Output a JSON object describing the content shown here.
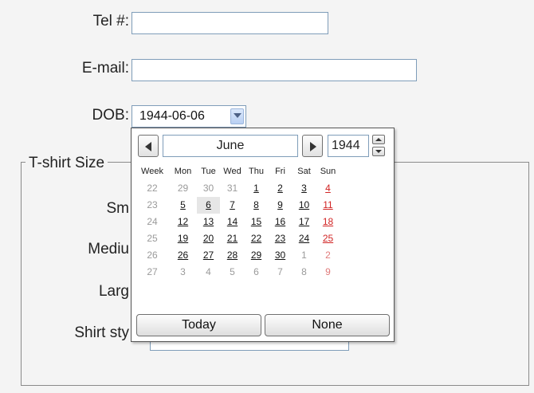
{
  "form": {
    "tel_label": "Tel #:",
    "email_label": "E-mail:",
    "dob_label": "DOB:",
    "dob_value": "1944-06-06",
    "tshirt_legend": "T-shirt Size",
    "size_small_label": "Sm",
    "size_medium_label": "Mediu",
    "size_large_label": "Larg",
    "shirt_style_label": "Shirt sty"
  },
  "calendar": {
    "month": "June",
    "year": "1944",
    "headers": [
      "Week",
      "Mon",
      "Tue",
      "Wed",
      "Thu",
      "Fri",
      "Sat",
      "Sun"
    ],
    "weeks": [
      {
        "week": "22",
        "days": [
          {
            "d": "29",
            "t": "other"
          },
          {
            "d": "30",
            "t": "other"
          },
          {
            "d": "31",
            "t": "other"
          },
          {
            "d": "1",
            "t": "cur"
          },
          {
            "d": "2",
            "t": "cur"
          },
          {
            "d": "3",
            "t": "cur"
          },
          {
            "d": "4",
            "t": "cur"
          }
        ]
      },
      {
        "week": "23",
        "days": [
          {
            "d": "5",
            "t": "cur"
          },
          {
            "d": "6",
            "t": "sel"
          },
          {
            "d": "7",
            "t": "cur"
          },
          {
            "d": "8",
            "t": "cur"
          },
          {
            "d": "9",
            "t": "cur"
          },
          {
            "d": "10",
            "t": "cur"
          },
          {
            "d": "11",
            "t": "cur"
          }
        ]
      },
      {
        "week": "24",
        "days": [
          {
            "d": "12",
            "t": "cur"
          },
          {
            "d": "13",
            "t": "cur"
          },
          {
            "d": "14",
            "t": "cur"
          },
          {
            "d": "15",
            "t": "cur"
          },
          {
            "d": "16",
            "t": "cur"
          },
          {
            "d": "17",
            "t": "cur"
          },
          {
            "d": "18",
            "t": "cur"
          }
        ]
      },
      {
        "week": "25",
        "days": [
          {
            "d": "19",
            "t": "cur"
          },
          {
            "d": "20",
            "t": "cur"
          },
          {
            "d": "21",
            "t": "cur"
          },
          {
            "d": "22",
            "t": "cur"
          },
          {
            "d": "23",
            "t": "cur"
          },
          {
            "d": "24",
            "t": "cur"
          },
          {
            "d": "25",
            "t": "cur"
          }
        ]
      },
      {
        "week": "26",
        "days": [
          {
            "d": "26",
            "t": "cur"
          },
          {
            "d": "27",
            "t": "cur"
          },
          {
            "d": "28",
            "t": "cur"
          },
          {
            "d": "29",
            "t": "cur"
          },
          {
            "d": "30",
            "t": "cur"
          },
          {
            "d": "1",
            "t": "other"
          },
          {
            "d": "2",
            "t": "other"
          }
        ]
      },
      {
        "week": "27",
        "days": [
          {
            "d": "3",
            "t": "other"
          },
          {
            "d": "4",
            "t": "other"
          },
          {
            "d": "5",
            "t": "other"
          },
          {
            "d": "6",
            "t": "other"
          },
          {
            "d": "7",
            "t": "other"
          },
          {
            "d": "8",
            "t": "other"
          },
          {
            "d": "9",
            "t": "other"
          }
        ]
      }
    ],
    "today_label": "Today",
    "none_label": "None"
  },
  "colors": {
    "sunday": "#d12424",
    "other_month": "#9a9a9a",
    "field_border": "#7f9db9"
  }
}
